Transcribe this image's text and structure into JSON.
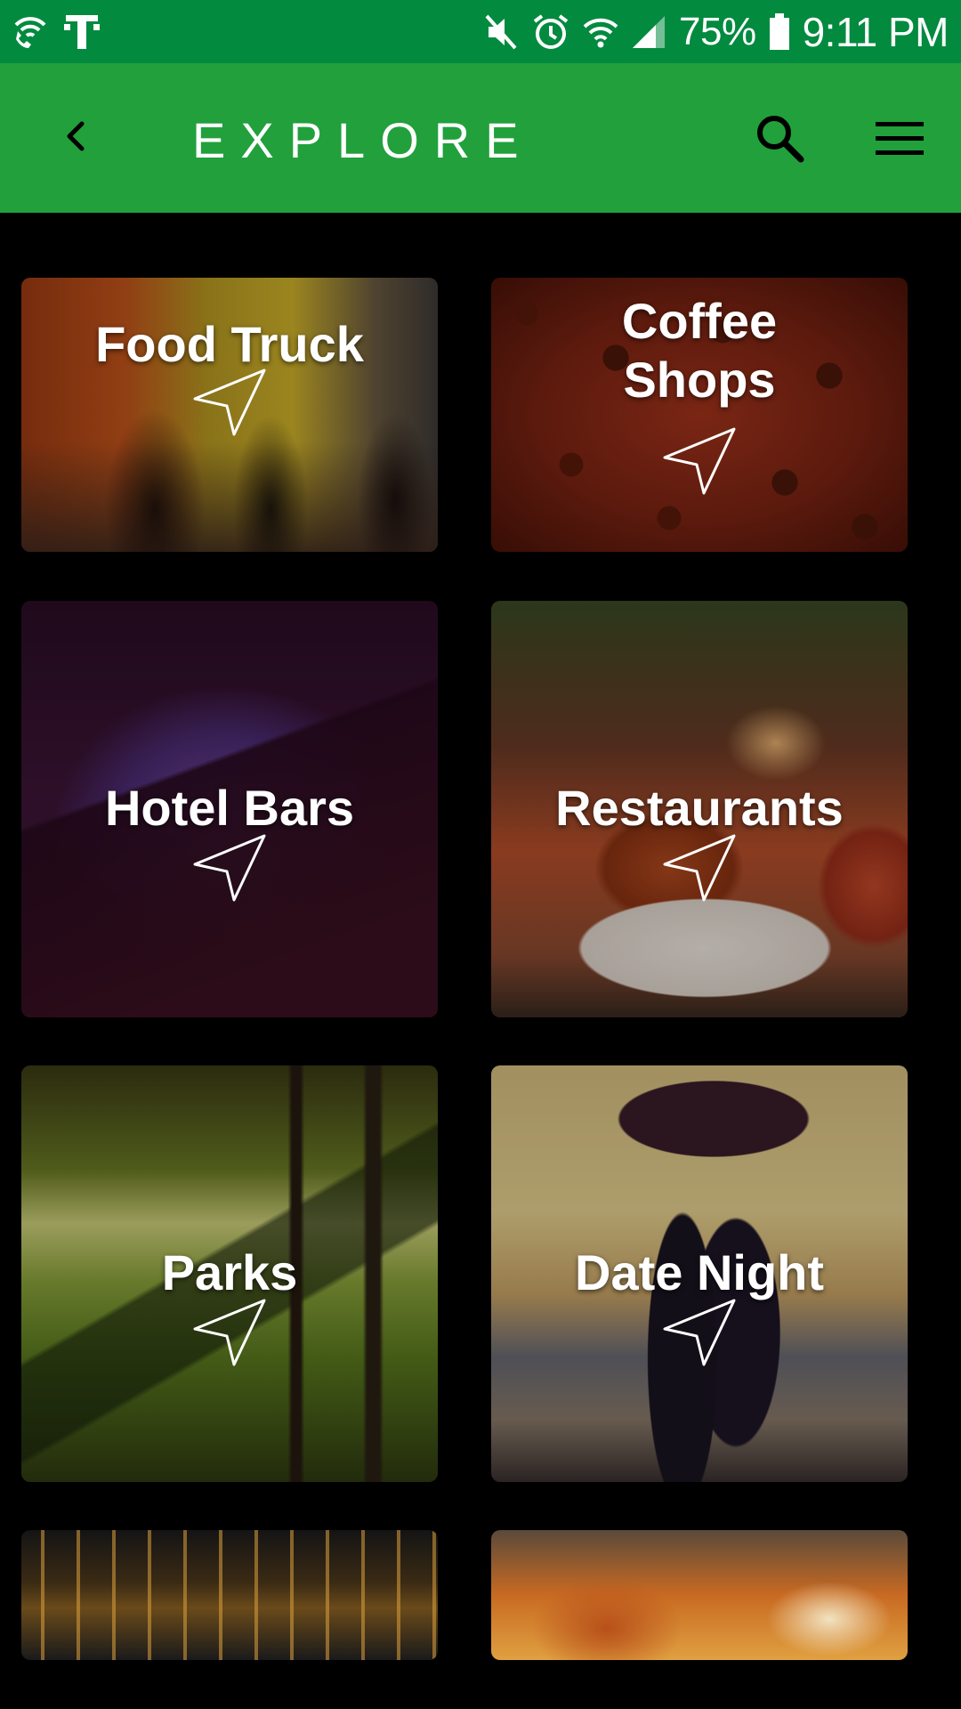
{
  "status_bar": {
    "battery_percent": "75%",
    "time": "9:11 PM",
    "icons": [
      "wifi-calling-icon",
      "carrier-logo-icon",
      "mute-icon",
      "alarm-icon",
      "wifi-icon",
      "signal-icon",
      "battery-icon"
    ]
  },
  "app_bar": {
    "title": "EXPLORE",
    "icons": [
      "back-arrow-icon",
      "search-icon",
      "hamburger-menu-icon"
    ]
  },
  "categories": [
    {
      "label": "Food Truck"
    },
    {
      "label": "Coffee Shops"
    },
    {
      "label": "Hotel Bars"
    },
    {
      "label": "Restaurants"
    },
    {
      "label": "Parks"
    },
    {
      "label": "Date Night"
    }
  ],
  "colors": {
    "status_bar": "#028a3f",
    "app_bar": "#21a03c",
    "background": "#000000",
    "text": "#ffffff"
  }
}
